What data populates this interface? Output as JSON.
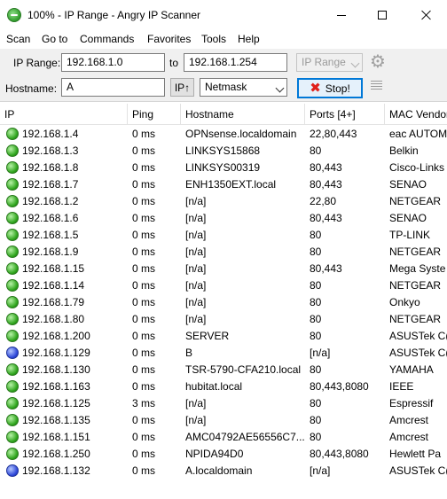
{
  "window": {
    "title": "100% - IP Range - Angry IP Scanner"
  },
  "menu": [
    "Scan",
    "Go to",
    "Commands",
    "Favorites",
    "Tools",
    "Help"
  ],
  "toolbar": {
    "ip_range_label": "IP Range:",
    "range_start": "192.168.1.0",
    "to_label": "to",
    "range_end": "192.168.1.254",
    "feeder_select": "IP Range",
    "hostname_label": "Hostname:",
    "hostname_value": "A",
    "ip_up_button": "IP↑",
    "netmask_select": "Netmask",
    "stop_button": "Stop!"
  },
  "table": {
    "columns": [
      "IP",
      "Ping",
      "Hostname",
      "Ports [4+]",
      "MAC Vendor"
    ],
    "rows": [
      {
        "status": "green",
        "ip": "192.168.1.4",
        "ping": "0 ms",
        "hostname": "OPNsense.localdomain",
        "ports": "22,80,443",
        "mac": "eac AUTOM"
      },
      {
        "status": "green",
        "ip": "192.168.1.3",
        "ping": "0 ms",
        "hostname": "LINKSYS15868",
        "ports": "80",
        "mac": "Belkin"
      },
      {
        "status": "green",
        "ip": "192.168.1.8",
        "ping": "0 ms",
        "hostname": "LINKSYS00319",
        "ports": "80,443",
        "mac": "Cisco-Links"
      },
      {
        "status": "green",
        "ip": "192.168.1.7",
        "ping": "0 ms",
        "hostname": "ENH1350EXT.local",
        "ports": "80,443",
        "mac": "SENAO"
      },
      {
        "status": "green",
        "ip": "192.168.1.2",
        "ping": "0 ms",
        "hostname": "[n/a]",
        "ports": "22,80",
        "mac": "NETGEAR"
      },
      {
        "status": "green",
        "ip": "192.168.1.6",
        "ping": "0 ms",
        "hostname": "[n/a]",
        "ports": "80,443",
        "mac": "SENAO"
      },
      {
        "status": "green",
        "ip": "192.168.1.5",
        "ping": "0 ms",
        "hostname": "[n/a]",
        "ports": "80",
        "mac": "TP-LINK"
      },
      {
        "status": "green",
        "ip": "192.168.1.9",
        "ping": "0 ms",
        "hostname": "[n/a]",
        "ports": "80",
        "mac": "NETGEAR"
      },
      {
        "status": "green",
        "ip": "192.168.1.15",
        "ping": "0 ms",
        "hostname": "[n/a]",
        "ports": "80,443",
        "mac": "Mega Syste"
      },
      {
        "status": "green",
        "ip": "192.168.1.14",
        "ping": "0 ms",
        "hostname": "[n/a]",
        "ports": "80",
        "mac": "NETGEAR"
      },
      {
        "status": "green",
        "ip": "192.168.1.79",
        "ping": "0 ms",
        "hostname": "[n/a]",
        "ports": "80",
        "mac": "Onkyo"
      },
      {
        "status": "green",
        "ip": "192.168.1.80",
        "ping": "0 ms",
        "hostname": "[n/a]",
        "ports": "80",
        "mac": "NETGEAR"
      },
      {
        "status": "green",
        "ip": "192.168.1.200",
        "ping": "0 ms",
        "hostname": "SERVER",
        "ports": "80",
        "mac": "ASUSTek C("
      },
      {
        "status": "blue",
        "ip": "192.168.1.129",
        "ping": "0 ms",
        "hostname": "B",
        "ports": "[n/a]",
        "mac": "ASUSTek C("
      },
      {
        "status": "green",
        "ip": "192.168.1.130",
        "ping": "0 ms",
        "hostname": "TSR-5790-CFA210.local",
        "ports": "80",
        "mac": "YAMAHA"
      },
      {
        "status": "green",
        "ip": "192.168.1.163",
        "ping": "0 ms",
        "hostname": "hubitat.local",
        "ports": "80,443,8080",
        "mac": "IEEE"
      },
      {
        "status": "green",
        "ip": "192.168.1.125",
        "ping": "3 ms",
        "hostname": "[n/a]",
        "ports": "80",
        "mac": "Espressif"
      },
      {
        "status": "green",
        "ip": "192.168.1.135",
        "ping": "0 ms",
        "hostname": "[n/a]",
        "ports": "80",
        "mac": "Amcrest"
      },
      {
        "status": "green",
        "ip": "192.168.1.151",
        "ping": "0 ms",
        "hostname": "AMC04792AE56556C7...",
        "ports": "80",
        "mac": "Amcrest"
      },
      {
        "status": "green",
        "ip": "192.168.1.250",
        "ping": "0 ms",
        "hostname": "NPIDA94D0",
        "ports": "80,443,8080",
        "mac": "Hewlett Pa"
      },
      {
        "status": "blue",
        "ip": "192.168.1.132",
        "ping": "0 ms",
        "hostname": "A.localdomain",
        "ports": "[n/a]",
        "mac": "ASUSTek C("
      }
    ]
  }
}
